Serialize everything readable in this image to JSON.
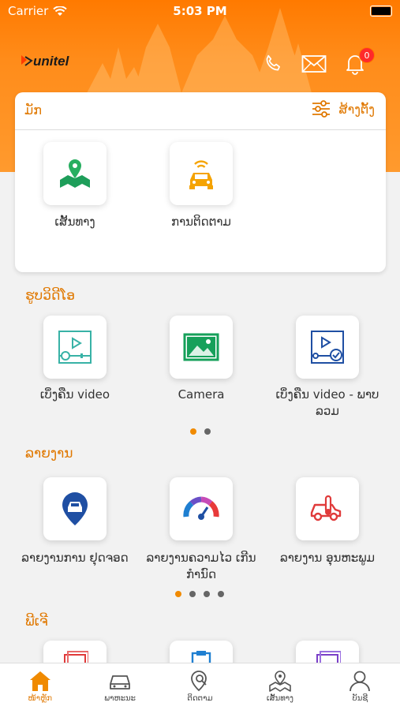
{
  "status_bar": {
    "carrier": "Carrier",
    "time": "5:03 PM"
  },
  "header": {
    "logo_text": "unitel",
    "notification_count": "0"
  },
  "main_card": {
    "title": "ມັກ",
    "setting_label": "ສ້າງຕັ້ງ",
    "items": [
      {
        "label": "ເສັ້ນທາງ",
        "icon": "map-pin-icon"
      },
      {
        "label": "ການຕິດຕາມ",
        "icon": "tracking-car-icon"
      }
    ]
  },
  "sections": {
    "video": {
      "title": "ຮູບວິດີໂອ",
      "items": [
        {
          "label": "ເບິ່ງຄືນ video",
          "icon": "video-playback-icon"
        },
        {
          "label": "Camera",
          "icon": "camera-image-icon"
        },
        {
          "label": "ເບິ່ງຄືນ video - ພາບລວມ",
          "icon": "video-overview-icon"
        }
      ],
      "page_count": 2,
      "active_page": 1
    },
    "report": {
      "title": "ລາຍງານ",
      "items": [
        {
          "label": "ລາຍງານການ ຢຸດຈອດ",
          "icon": "parking-report-icon"
        },
        {
          "label": "ລາຍງານຄວາມໄວ ເກີນກຳນົດ",
          "icon": "speed-gauge-icon"
        },
        {
          "label": "ລາຍງານ ອຸນຫະພູມ",
          "icon": "temperature-car-icon"
        }
      ],
      "page_count": 4,
      "active_page": 1
    },
    "fee": {
      "title": "ພີເຈີ"
    }
  },
  "tabbar": {
    "tabs": [
      {
        "label": "ໜ້າຫຼັກ",
        "icon": "home-icon",
        "active": true
      },
      {
        "label": "ພາຫະນະ",
        "icon": "vehicle-icon",
        "active": false
      },
      {
        "label": "ຕິດຕາມ",
        "icon": "track-search-icon",
        "active": false
      },
      {
        "label": "ເສັ້ນທາງ",
        "icon": "route-map-icon",
        "active": false
      },
      {
        "label": "ບັນຊີ",
        "icon": "account-icon",
        "active": false
      }
    ]
  },
  "colors": {
    "brand": "#ff7a00",
    "accent_text": "#e07800"
  }
}
